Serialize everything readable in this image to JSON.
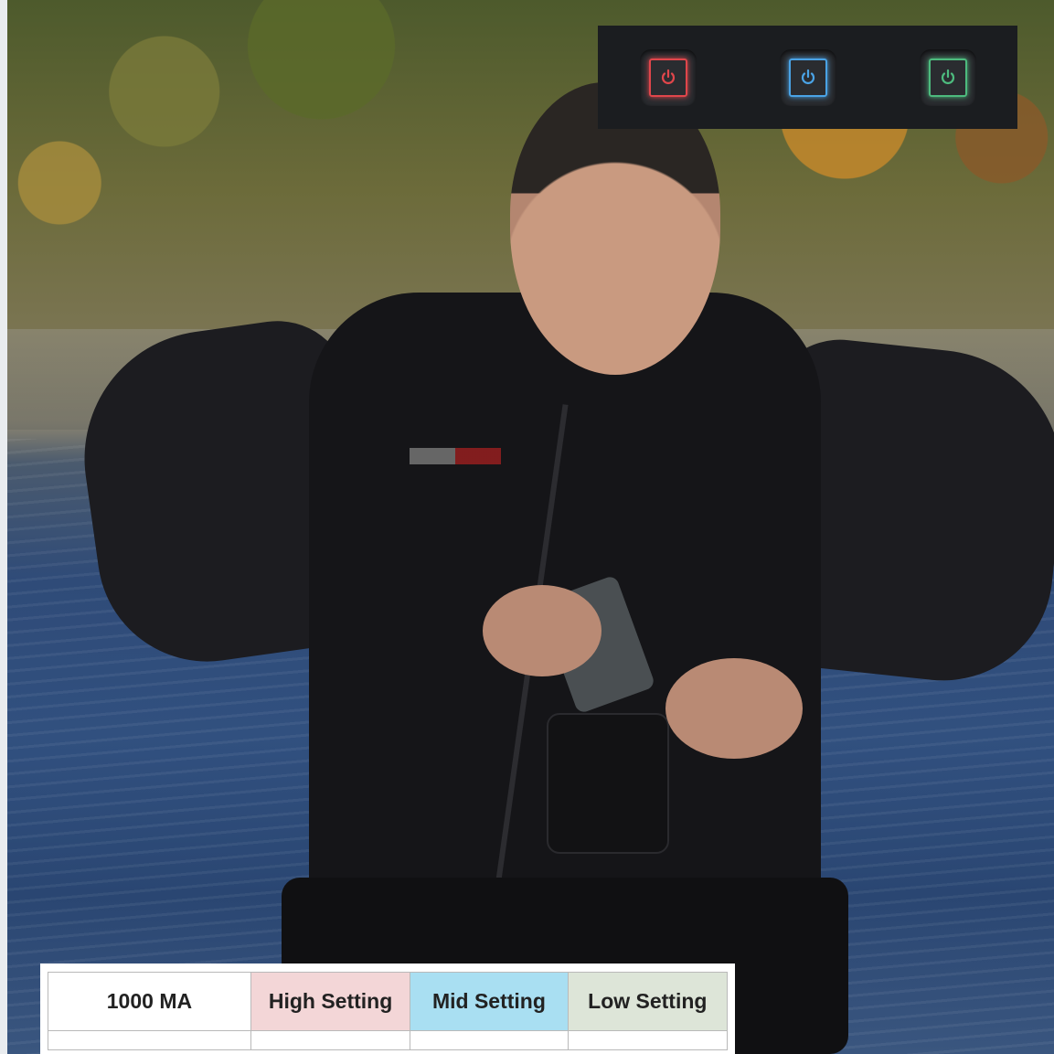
{
  "power_buttons": [
    {
      "icon": "power-icon",
      "color": "#e0464b"
    },
    {
      "icon": "power-icon",
      "color": "#4aa3e6"
    },
    {
      "icon": "power-icon",
      "color": "#4dbb7e"
    }
  ],
  "table": {
    "headers": [
      "1000 MA",
      "High Setting",
      "Mid Setting",
      "Low Setting"
    ],
    "header_colors": [
      "#ffffff",
      "#f3d6d7",
      "#a9dff2",
      "#dde5d8"
    ],
    "rows": [
      [
        "",
        "",
        "",
        ""
      ]
    ]
  }
}
